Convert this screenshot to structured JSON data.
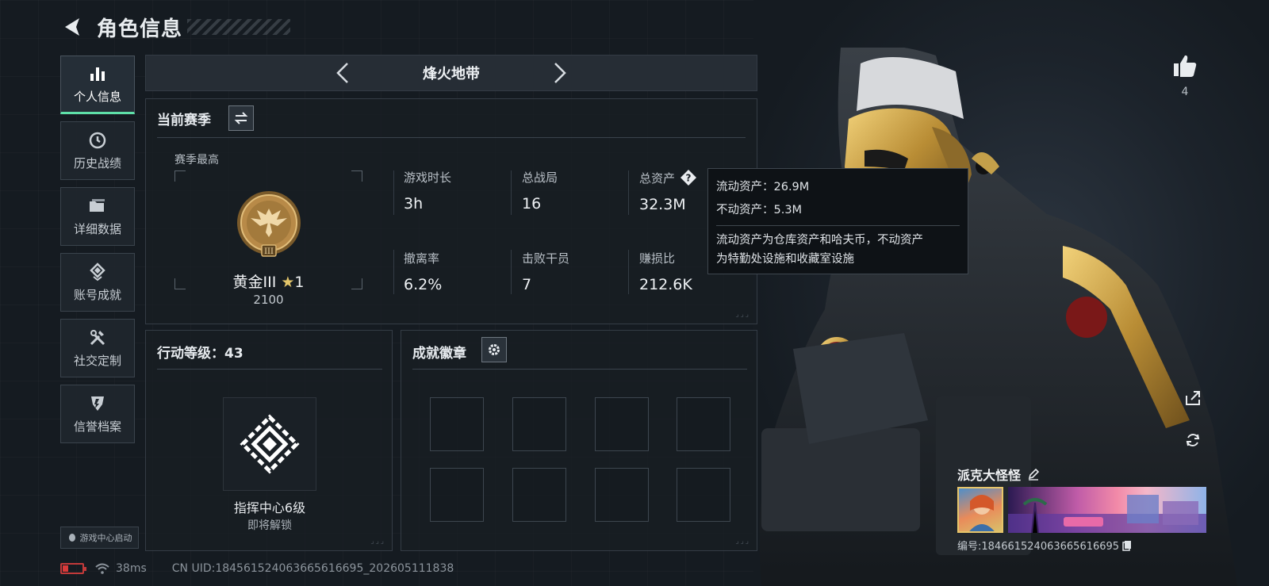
{
  "header": {
    "title": "角色信息"
  },
  "sidebar": {
    "items": [
      {
        "label": "个人信息",
        "icon": "bar-chart-icon",
        "active": true
      },
      {
        "label": "历史战绩",
        "icon": "clock-icon",
        "active": false
      },
      {
        "label": "详细数据",
        "icon": "folder-icon",
        "active": false
      },
      {
        "label": "账号成就",
        "icon": "medal-icon",
        "active": false
      },
      {
        "label": "社交定制",
        "icon": "tools-icon",
        "active": false
      },
      {
        "label": "信誉档案",
        "icon": "shield-icon",
        "active": false
      }
    ],
    "launch_label": "游戏中心启动"
  },
  "mode": {
    "title": "烽火地带"
  },
  "season": {
    "title": "当前赛季",
    "best_label": "赛季最高",
    "rank_name": "黄金III",
    "rank_stars": "1",
    "rank_score": "2100",
    "stats": [
      {
        "label": "游戏时长",
        "value": "3h"
      },
      {
        "label": "总战局",
        "value": "16"
      },
      {
        "label": "总资产",
        "value": "32.3M"
      },
      {
        "label": "撤离率",
        "value": "6.2%"
      },
      {
        "label": "击败干员",
        "value": "7"
      },
      {
        "label": "赚损比",
        "value": "212.6K"
      }
    ]
  },
  "tooltip": {
    "liquid": "流动资产：26.9M",
    "fixed": "不动资产：5.3M",
    "desc_line1": "流动资产为仓库资产和哈夫币，不动资产",
    "desc_line2": "为特勤处设施和收藏室设施"
  },
  "level": {
    "title": "行动等级：43",
    "unlock_name": "指挥中心6级",
    "unlock_status": "即将解锁"
  },
  "badges": {
    "title": "成就徽章",
    "slot_count": 8
  },
  "profile": {
    "like_count": "4",
    "player_name": "派克大怪怪",
    "player_id": "编号:1846615240636656166​95"
  },
  "status": {
    "ping": "38ms",
    "uid": "CN UID:184561524063665616695_202605111838"
  },
  "colors": {
    "accent": "#5ee0a8",
    "gold": "#c8a24a",
    "battery_low": "#d93a3a"
  }
}
